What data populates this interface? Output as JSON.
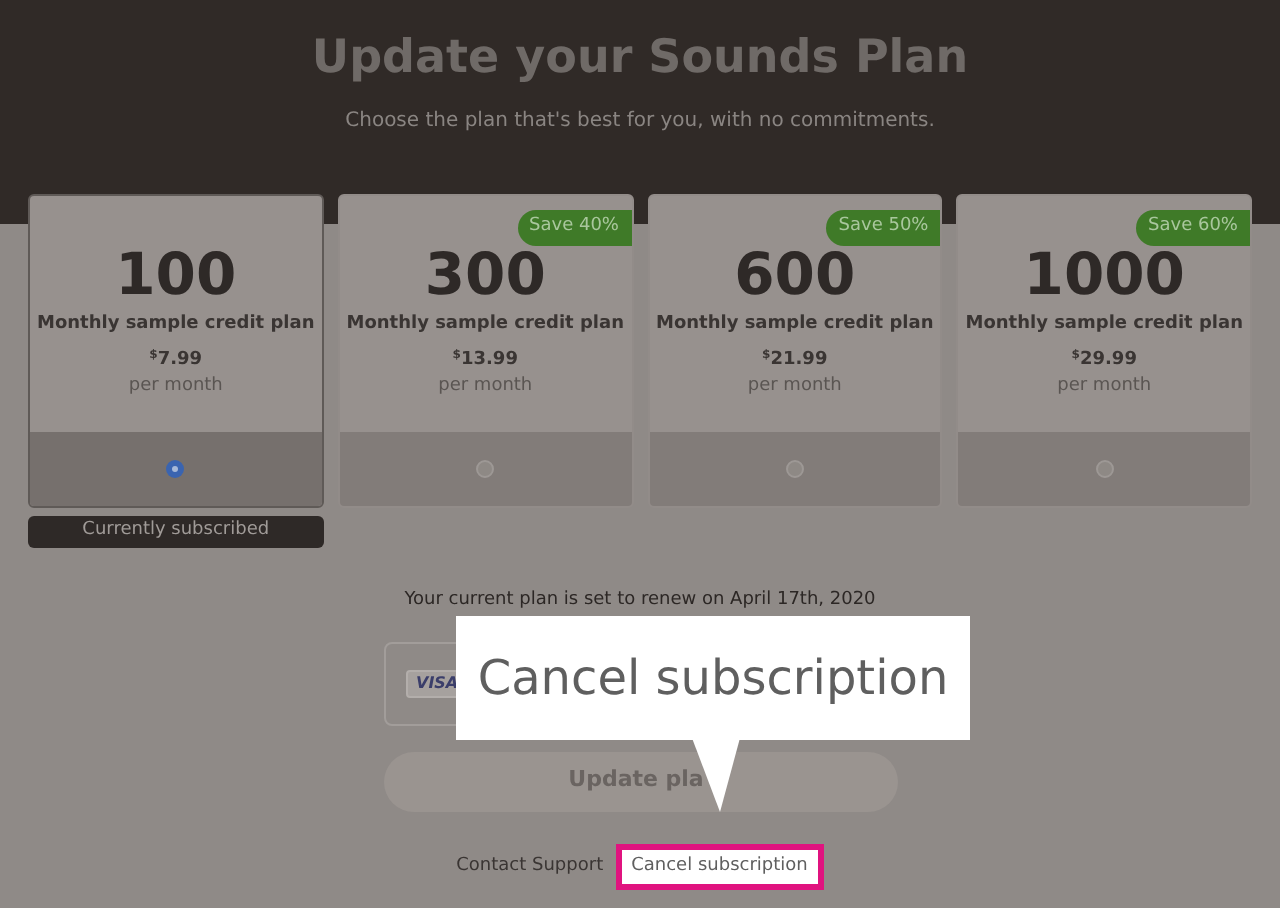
{
  "header": {
    "title": "Update your Sounds Plan",
    "subtitle": "Choose the plan that's best for you, with no commitments."
  },
  "plans": [
    {
      "credits": "100",
      "description": "Monthly sample credit plan",
      "currency": "$",
      "amount": "7.99",
      "period": "per month",
      "selected": true
    },
    {
      "credits": "300",
      "description": "Monthly sample credit plan",
      "currency": "$",
      "amount": "13.99",
      "period": "per month",
      "badge": "Save 40%",
      "selected": false
    },
    {
      "credits": "600",
      "description": "Monthly sample credit plan",
      "currency": "$",
      "amount": "21.99",
      "period": "per month",
      "badge": "Save 50%",
      "selected": false
    },
    {
      "credits": "1000",
      "description": "Monthly sample credit plan",
      "currency": "$",
      "amount": "29.99",
      "period": "per month",
      "badge": "Save 60%",
      "selected": false
    }
  ],
  "current_label": "Currently subscribed",
  "renewal": "Your current plan is set to renew on April 17th, 2020",
  "payment_card": {
    "brand": "VISA"
  },
  "update_button": "Update pla",
  "footer_links": [
    {
      "label": "Contact Support",
      "highlighted": false
    },
    {
      "label": "Cancel subscription",
      "highlighted": true
    }
  ],
  "callout": "Cancel subscription"
}
